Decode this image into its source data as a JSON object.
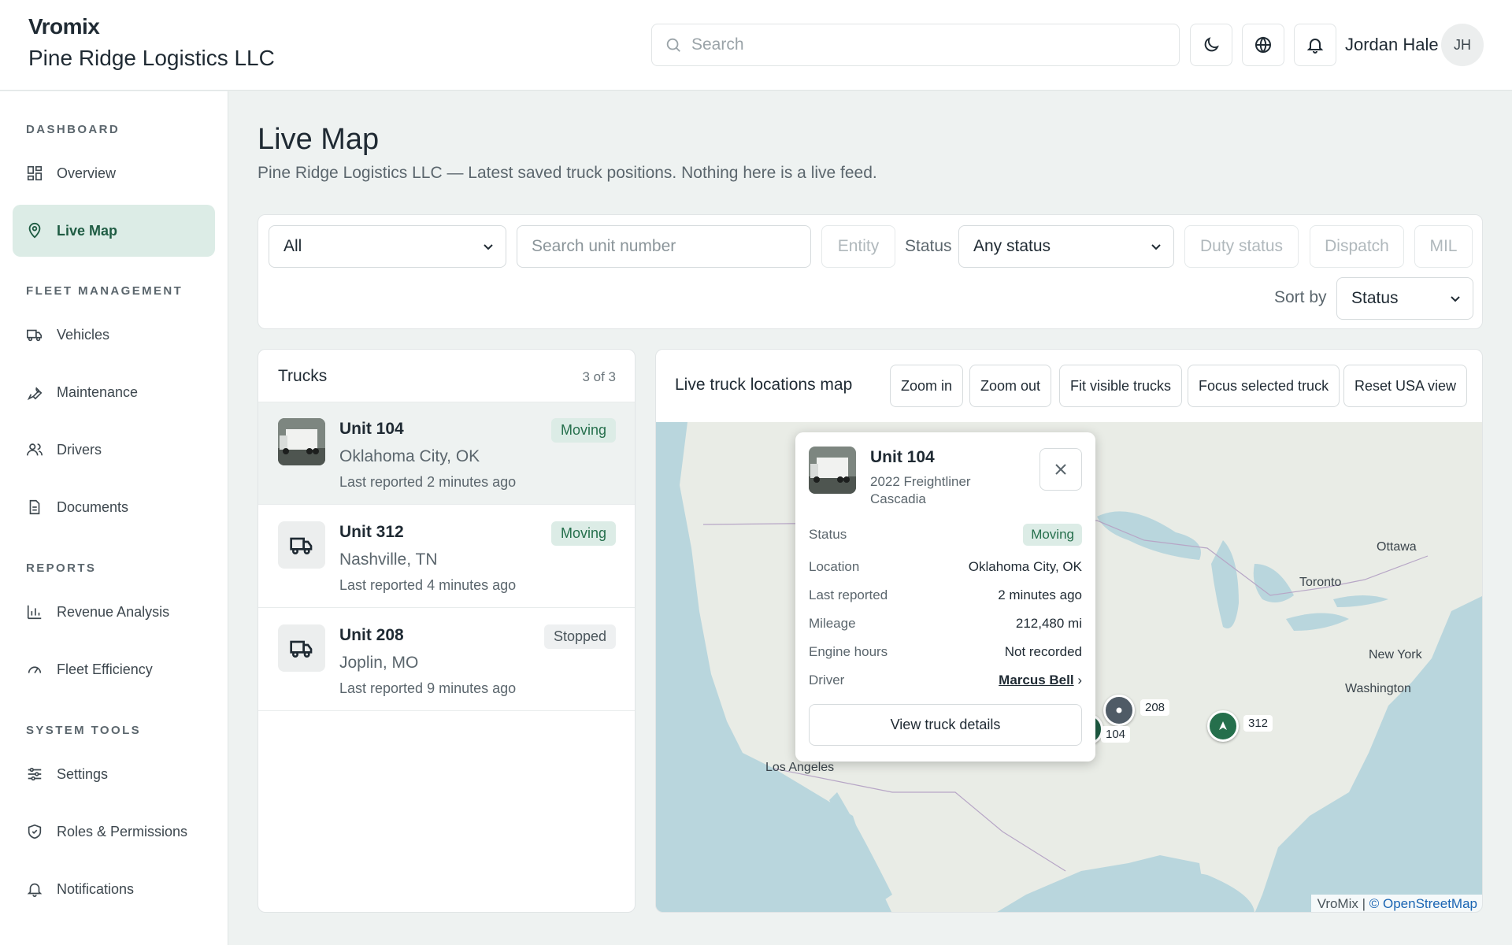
{
  "header": {
    "logo_text": "Vromix",
    "company_name": "Pine Ridge Logistics LLC",
    "search_placeholder": "Search",
    "user_name": "Jordan Hale",
    "user_initials": "JH",
    "icons": [
      "moon-icon",
      "globe-icon",
      "bell-icon"
    ]
  },
  "sidebar": {
    "sections": [
      {
        "title": "DASHBOARD",
        "items": [
          {
            "label": "Overview",
            "icon": "grid-icon"
          },
          {
            "label": "Live Map",
            "icon": "map-pin-icon",
            "active": true
          }
        ]
      },
      {
        "title": "FLEET MANAGEMENT",
        "items": [
          {
            "label": "Vehicles",
            "icon": "truck-icon"
          },
          {
            "label": "Maintenance",
            "icon": "wrench-icon"
          },
          {
            "label": "Drivers",
            "icon": "users-icon"
          },
          {
            "label": "Documents",
            "icon": "document-icon"
          }
        ]
      },
      {
        "title": "REPORTS",
        "items": [
          {
            "label": "Revenue Analysis",
            "icon": "bar-chart-icon"
          },
          {
            "label": "Fleet Efficiency",
            "icon": "gauge-icon"
          }
        ]
      },
      {
        "title": "SYSTEM TOOLS",
        "items": [
          {
            "label": "Settings",
            "icon": "sliders-icon"
          },
          {
            "label": "Roles & Permissions",
            "icon": "shield-icon"
          },
          {
            "label": "Notifications",
            "icon": "bell-icon"
          }
        ]
      }
    ]
  },
  "page": {
    "title": "Live Map",
    "subtitle": "Pine Ridge Logistics LLC — Latest saved truck positions. Nothing here is a live feed."
  },
  "filters": {
    "scope_value": "All",
    "unit_search_placeholder": "Search unit number",
    "entity_label": "Entity",
    "status_label": "Status",
    "status_value": "Any status",
    "duty_status_label": "Duty status",
    "dispatch_label": "Dispatch",
    "mil_label": "MIL",
    "sort_label": "Sort by",
    "sort_value": "Status"
  },
  "trucks": {
    "title": "Trucks",
    "count": "3 of 3",
    "items": [
      {
        "name": "Unit 104",
        "city": "Oklahoma City, OK",
        "last_reported": "Last reported 2 minutes ago",
        "status": "Moving",
        "selected": true
      },
      {
        "name": "Unit 312",
        "city": "Nashville, TN",
        "last_reported": "Last reported 4 minutes ago",
        "status": "Moving"
      },
      {
        "name": "Unit 208",
        "city": "Joplin, MO",
        "last_reported": "Last reported 9 minutes ago",
        "status": "Stopped"
      }
    ]
  },
  "map": {
    "title": "Live truck locations map",
    "buttons": [
      "Zoom in",
      "Zoom out",
      "Fit visible trucks",
      "Focus selected truck",
      "Reset USA view"
    ],
    "place_labels": [
      "Ottawa",
      "Toronto",
      "New York",
      "Washington",
      "Los Angeles"
    ],
    "markers": [
      {
        "unit": "208",
        "status": "Stopped",
        "color": "#4f5b66"
      },
      {
        "unit": "104",
        "status": "Moving",
        "color": "#1f5c43"
      },
      {
        "unit": "312",
        "status": "Moving",
        "color": "#256f4c"
      }
    ],
    "attribution_prefix": "VroMix | ",
    "attribution_link": "© OpenStreetMap"
  },
  "popup": {
    "unit": "Unit 104",
    "model": "2022 Freightliner Cascadia",
    "rows": [
      {
        "key": "Status",
        "value": "Moving"
      },
      {
        "key": "Location",
        "value": "Oklahoma City, OK"
      },
      {
        "key": "Last reported",
        "value": "2 minutes ago"
      },
      {
        "key": "Mileage",
        "value": "212,480 mi"
      },
      {
        "key": "Engine hours",
        "value": "Not recorded"
      },
      {
        "key": "Driver",
        "value": "Marcus Bell"
      }
    ],
    "details_button": "View truck details"
  },
  "colors": {
    "accent": "#1f5c43",
    "accent_bg": "#dcece6",
    "page_bg": "#eef2f1",
    "water": "#b9d6dd",
    "land": "#e9ece6"
  }
}
